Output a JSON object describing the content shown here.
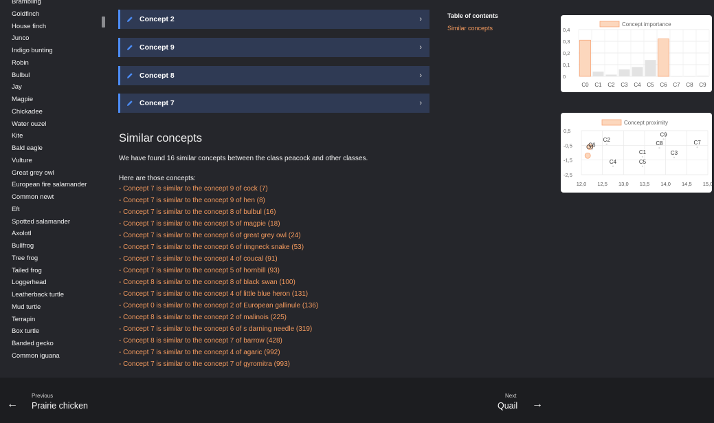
{
  "sidebar": {
    "items": [
      "Brambling",
      "Goldfinch",
      "House finch",
      "Junco",
      "Indigo bunting",
      "Robin",
      "Bulbul",
      "Jay",
      "Magpie",
      "Chickadee",
      "Water ouzel",
      "Kite",
      "Bald eagle",
      "Vulture",
      "Great grey owl",
      "European fire salamander",
      "Common newt",
      "Eft",
      "Spotted salamander",
      "Axolotl",
      "Bullfrog",
      "Tree frog",
      "Tailed frog",
      "Loggerhead",
      "Leatherback turtle",
      "Mud turtle",
      "Terrapin",
      "Box turtle",
      "Banded gecko",
      "Common iguana"
    ]
  },
  "concepts": [
    {
      "label": "Concept 2"
    },
    {
      "label": "Concept 9"
    },
    {
      "label": "Concept 8"
    },
    {
      "label": "Concept 7"
    }
  ],
  "similar": {
    "title": "Similar concepts",
    "intro": "We have found 16 similar concepts between the class peacock and other classes.",
    "list_head": "Here are those concepts:",
    "items": [
      "- Concept 7 is similar to the concept 9 of cock (7)",
      "- Concept 7 is similar to the concept 9 of hen (8)",
      "- Concept 7 is similar to the concept 8 of bulbul (16)",
      "- Concept 7 is similar to the concept 5 of magpie (18)",
      "- Concept 7 is similar to the concept 6 of great grey owl (24)",
      "- Concept 7 is similar to the concept 6 of ringneck snake (53)",
      "- Concept 7 is similar to the concept 4 of coucal (91)",
      "- Concept 7 is similar to the concept 5 of hornbill (93)",
      "- Concept 8 is similar to the concept 8 of black swan (100)",
      "- Concept 7 is similar to the concept 4 of little blue heron (131)",
      "- Concept 0 is similar to the concept 2 of European gallinule (136)",
      "- Concept 8 is similar to the concept 2 of malinois (225)",
      "- Concept 7 is similar to the concept 6 of s darning needle (319)",
      "- Concept 8 is similar to the concept 7 of barrow (428)",
      "- Concept 7 is similar to the concept 4 of agaric (992)",
      "- Concept 7 is similar to the concept 7 of gyromitra (993)"
    ]
  },
  "toc": {
    "title": "Table of contents",
    "link": "Similar concepts"
  },
  "footer": {
    "prev_small": "Previous",
    "prev_title": "Prairie chicken",
    "next_small": "Next",
    "next_title": "Quail"
  },
  "colors": {
    "accent": "#4c8cf5",
    "link": "#f39a5e",
    "bar_highlight": "#fcd7bd",
    "bar_highlight_border": "#f7a677",
    "bar_other": "#e3e3e3"
  },
  "chart_data": [
    {
      "type": "bar",
      "legend": "Concept importance",
      "legend_position": "top",
      "categories": [
        "C0",
        "C1",
        "C2",
        "C3",
        "C4",
        "C5",
        "C6",
        "C7",
        "C8",
        "C9"
      ],
      "values": [
        0.31,
        0.04,
        0.015,
        0.06,
        0.08,
        0.14,
        0.32,
        0.0,
        0.0,
        0.005
      ],
      "highlighted": [
        0,
        6
      ],
      "ylim": [
        0,
        0.4
      ],
      "yticks": [
        "0,4",
        "0,3",
        "0,2",
        "0,1",
        "0"
      ],
      "grid": true
    },
    {
      "type": "scatter",
      "legend": "Concept proximity",
      "legend_position": "top",
      "xlim": [
        12.0,
        15.0
      ],
      "ylim": [
        -2.5,
        0.5
      ],
      "xticks": [
        "12,0",
        "12,5",
        "13,0",
        "13,5",
        "14,0",
        "14,5",
        "15,0"
      ],
      "yticks": [
        "0,5",
        "-0,5",
        "-1,5",
        "-2,5"
      ],
      "points": [
        {
          "label": "C0",
          "x": 12.2,
          "y": -0.6,
          "highlight": true
        },
        {
          "label": "",
          "x": 12.15,
          "y": -1.2,
          "highlight": true
        },
        {
          "label": "C6",
          "x": 12.25,
          "y": -0.45,
          "highlight": false
        },
        {
          "label": "C2",
          "x": 12.6,
          "y": -0.1,
          "highlight": false
        },
        {
          "label": "C9",
          "x": 13.95,
          "y": 0.25,
          "highlight": false
        },
        {
          "label": "C8",
          "x": 13.85,
          "y": -0.35,
          "highlight": false
        },
        {
          "label": "C7",
          "x": 14.75,
          "y": -0.3,
          "highlight": false
        },
        {
          "label": "C1",
          "x": 13.45,
          "y": -0.95,
          "highlight": false
        },
        {
          "label": "C3",
          "x": 14.2,
          "y": -1.0,
          "highlight": false
        },
        {
          "label": "C4",
          "x": 12.75,
          "y": -1.6,
          "highlight": false
        },
        {
          "label": "C5",
          "x": 13.45,
          "y": -1.6,
          "highlight": false
        }
      ]
    }
  ]
}
